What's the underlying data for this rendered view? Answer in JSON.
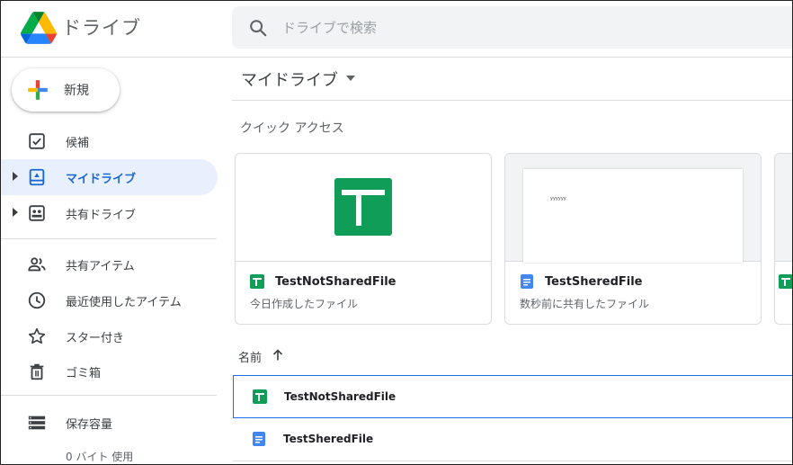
{
  "app": {
    "title": "ドライブ"
  },
  "search": {
    "placeholder": "ドライブで検索",
    "value": ""
  },
  "sidebar": {
    "new_label": "新規",
    "items": [
      {
        "label": "候補",
        "icon": "check-box-icon"
      },
      {
        "label": "マイドライブ",
        "icon": "my-drive-icon",
        "active": true
      },
      {
        "label": "共有ドライブ",
        "icon": "shared-drives-icon"
      },
      {
        "label": "共有アイテム",
        "icon": "people-icon"
      },
      {
        "label": "最近使用したアイテム",
        "icon": "clock-icon"
      },
      {
        "label": "スター付き",
        "icon": "star-icon"
      },
      {
        "label": "ゴミ箱",
        "icon": "trash-icon"
      },
      {
        "label": "保存容量",
        "icon": "storage-icon"
      }
    ],
    "storage_used": "0 バイト 使用"
  },
  "main": {
    "title": "マイドライブ",
    "quick_access_heading": "クイック アクセス",
    "quick_access": [
      {
        "name": "TestNotSharedFile",
        "subtitle": "今日作成したファイル",
        "type": "sheets"
      },
      {
        "name": "TestSheredFile",
        "subtitle": "数秒前に共有したファイル",
        "type": "docs",
        "preview_text": "yyyyyy"
      }
    ],
    "list_header": {
      "name_column": "名前"
    },
    "files": [
      {
        "name": "TestNotSharedFile",
        "type": "sheets",
        "selected": true
      },
      {
        "name": "TestSheredFile",
        "type": "docs"
      }
    ]
  },
  "colors": {
    "accent_blue": "#1a73e8",
    "active_bg": "#e8f0fe",
    "sheets_green": "#0f9d58",
    "docs_blue": "#4285f4"
  }
}
